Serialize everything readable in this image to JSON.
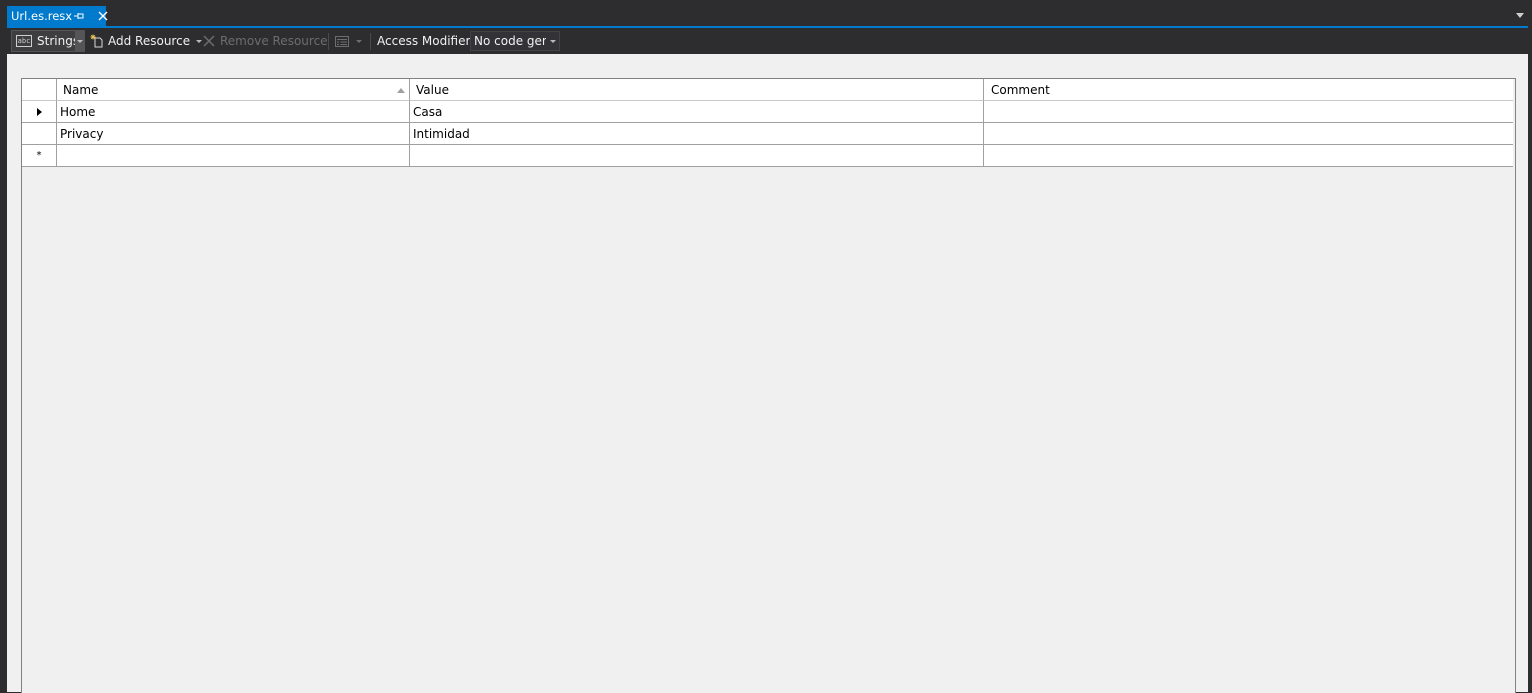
{
  "tab": {
    "title": "Url.es.resx"
  },
  "toolbar": {
    "strings_label": "Strings",
    "strings_icon_text": "abc",
    "add_resource_label": "Add Resource",
    "remove_resource_label": "Remove Resource",
    "access_modifier_label": "Access Modifier:",
    "access_modifier_value": "No code generation"
  },
  "grid": {
    "columns": [
      "Name",
      "Value",
      "Comment"
    ],
    "sorted_column": "Name",
    "rows": [
      {
        "name": "Home",
        "value": "Casa",
        "comment": ""
      },
      {
        "name": "Privacy",
        "value": "Intimidad",
        "comment": ""
      }
    ],
    "new_row_marker": "*"
  },
  "colors": {
    "accent": "#007acc",
    "chrome": "#2d2d30",
    "editor_bg": "#f0f0f0"
  }
}
